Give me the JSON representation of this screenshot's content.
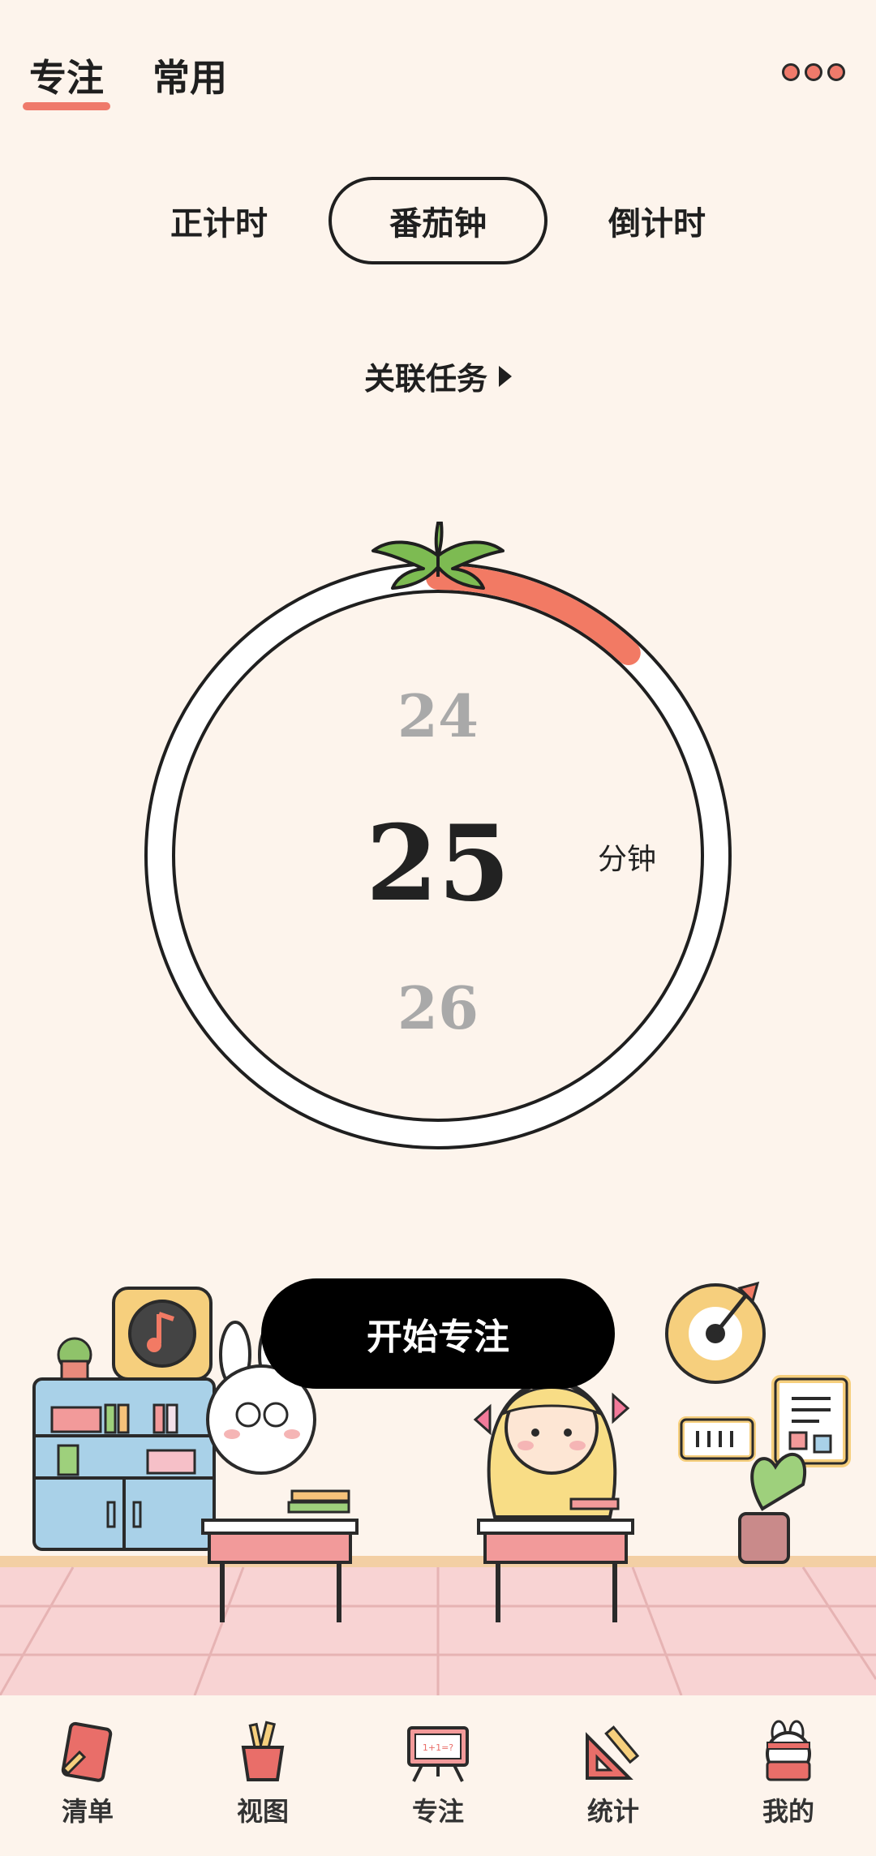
{
  "top_tabs": [
    {
      "label": "专注",
      "active": true
    },
    {
      "label": "常用",
      "active": false
    }
  ],
  "mode_tabs": [
    {
      "label": "正计时",
      "active": false
    },
    {
      "label": "番茄钟",
      "active": true
    },
    {
      "label": "倒计时",
      "active": false
    }
  ],
  "related_task": {
    "label": "关联任务"
  },
  "timer": {
    "prev_value": "24",
    "current_value": "25",
    "next_value": "26",
    "unit": "分钟",
    "progress_fraction": 0.12,
    "progress_color": "#f27a64"
  },
  "start_button": {
    "label": "开始专注"
  },
  "bottom_nav": [
    {
      "label": "清单",
      "icon": "notebook-icon"
    },
    {
      "label": "视图",
      "icon": "pencil-cup-icon"
    },
    {
      "label": "专注",
      "icon": "blackboard-icon",
      "active": true
    },
    {
      "label": "统计",
      "icon": "ruler-triangle-icon"
    },
    {
      "label": "我的",
      "icon": "bunny-reading-icon"
    }
  ],
  "colors": {
    "background": "#fdf4ec",
    "accent": "#ef7a6b",
    "floor": "#f7cfcf"
  }
}
